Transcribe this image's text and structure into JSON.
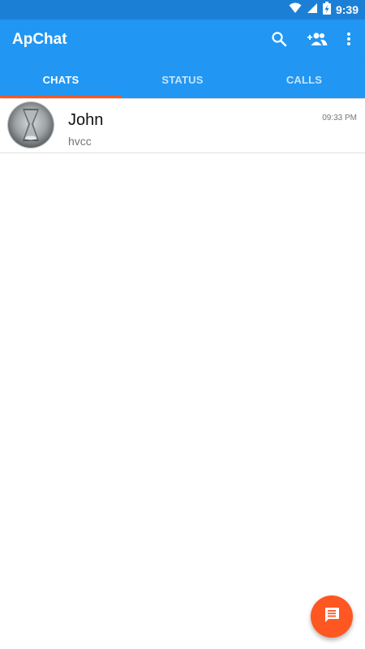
{
  "status_bar": {
    "time": "9:39",
    "icons": [
      "wifi-icon",
      "signal-icon",
      "battery-charging-icon"
    ]
  },
  "app_bar": {
    "title": "ApChat",
    "actions": [
      "search-icon",
      "add-friend-icon",
      "more-vert-icon"
    ]
  },
  "tabs": [
    {
      "label": "CHATS",
      "active": true
    },
    {
      "label": "STATUS",
      "active": false
    },
    {
      "label": "CALLS",
      "active": false
    }
  ],
  "chats": [
    {
      "name": "John",
      "preview": "hvcc",
      "time": "09:33 PM",
      "avatar": "avatar-photo"
    }
  ],
  "fab": {
    "icon": "new-message-icon"
  },
  "colors": {
    "primary": "#2196f3",
    "status_bar": "#1c7fd6",
    "accent": "#ff5722",
    "tab_indicator": "#ff5722"
  }
}
